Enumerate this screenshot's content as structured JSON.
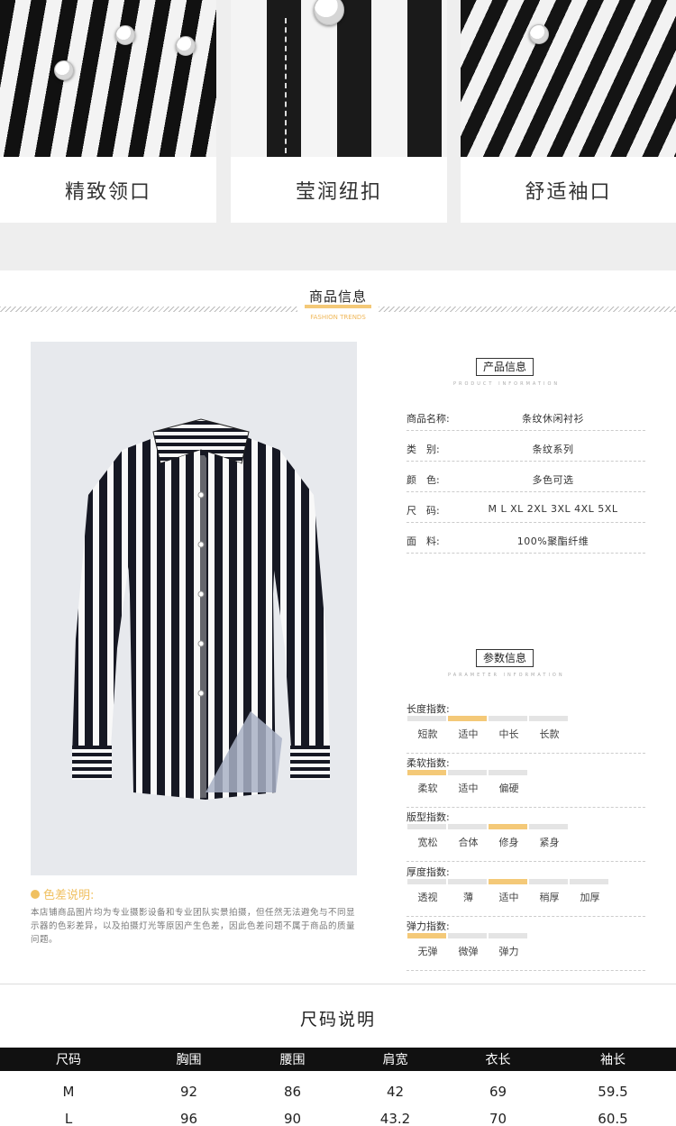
{
  "details": [
    {
      "label": "精致领口"
    },
    {
      "label": "莹润纽扣"
    },
    {
      "label": "舒适袖口"
    }
  ],
  "section": {
    "title": "商品信息",
    "subtitle": "FASHION TRENDS"
  },
  "color_note": {
    "title": "色差说明:",
    "text": "本店铺商品图片均为专业摄影设备和专业团队实景拍摄，但任然无法避免与不同显示器的色彩差异，以及拍摄灯光等原因产生色差，因此色差问题不属于商品的质量问题。"
  },
  "product_info": {
    "title": "产品信息",
    "subtitle": "PRODUCT INFORMATION",
    "rows": [
      {
        "label": "商品名称:",
        "value": "条纹休闲衬衫"
      },
      {
        "label": "类　别:",
        "value": "条纹系列"
      },
      {
        "label": "颜　色:",
        "value": "多色可选"
      },
      {
        "label": "尺　码:",
        "value": "M  L  XL  2XL  3XL  4XL  5XL"
      },
      {
        "label": "面　料:",
        "value": "100%聚酯纤维"
      }
    ]
  },
  "param_info": {
    "title": "参数信息",
    "subtitle": "PARAMETER INFORMATION",
    "params": [
      {
        "label": "长度指数:",
        "options": [
          "短款",
          "适中",
          "中长",
          "长款"
        ],
        "selected": 1
      },
      {
        "label": "柔软指数:",
        "options": [
          "柔软",
          "适中",
          "偏硬"
        ],
        "selected": 0
      },
      {
        "label": "版型指数:",
        "options": [
          "宽松",
          "合体",
          "修身",
          "紧身"
        ],
        "selected": 2
      },
      {
        "label": "厚度指数:",
        "options": [
          "透视",
          "薄",
          "适中",
          "稍厚",
          "加厚"
        ],
        "selected": 2
      },
      {
        "label": "弹力指数:",
        "options": [
          "无弹",
          "微弹",
          "弹力"
        ],
        "selected": 0
      }
    ]
  },
  "size_chart": {
    "title": "尺码说明",
    "headers": [
      "尺码",
      "胸围",
      "腰围",
      "肩宽",
      "衣长",
      "袖长"
    ],
    "rows": [
      [
        "M",
        "92",
        "86",
        "42",
        "69",
        "59.5"
      ],
      [
        "L",
        "96",
        "90",
        "43.2",
        "70",
        "60.5"
      ]
    ]
  }
}
